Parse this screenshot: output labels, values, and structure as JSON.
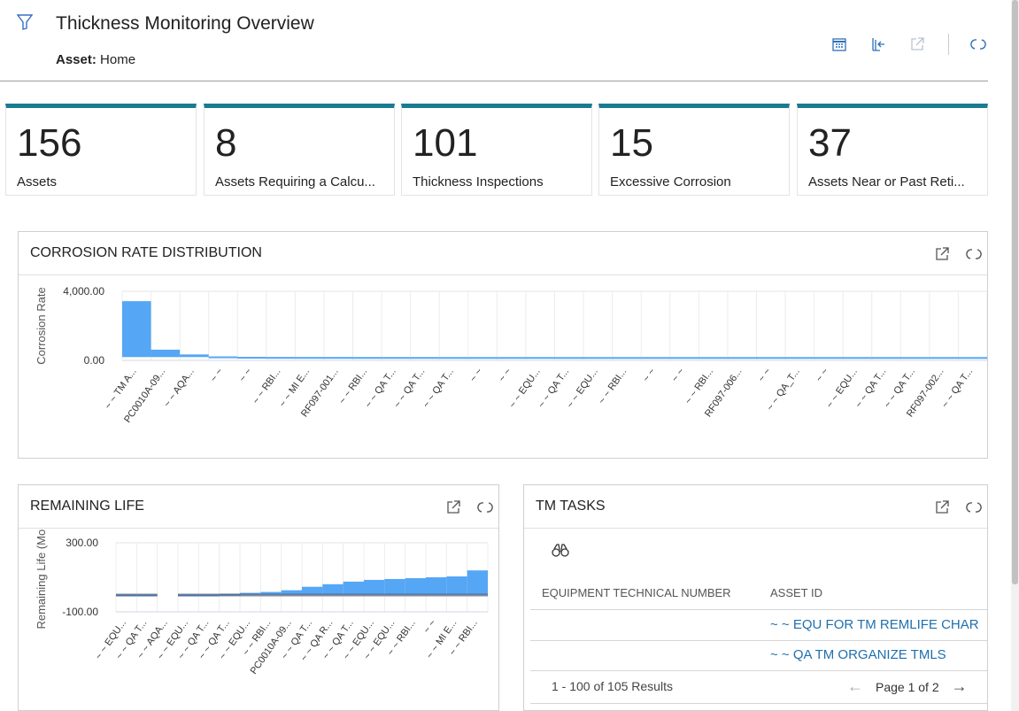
{
  "header": {
    "title": "Thickness Monitoring Overview",
    "asset_label": "Asset:",
    "asset_value": "Home",
    "tools": [
      "calendar-icon",
      "import-icon",
      "open-external-icon",
      "refresh-icon"
    ]
  },
  "kpis": [
    {
      "value": "156",
      "label": "Assets"
    },
    {
      "value": "8",
      "label": "Assets Requiring a Calcu..."
    },
    {
      "value": "101",
      "label": "Thickness Inspections"
    },
    {
      "value": "15",
      "label": "Excessive Corrosion"
    },
    {
      "value": "37",
      "label": "Assets Near or Past Reti..."
    }
  ],
  "colors": {
    "accent": "#1a7b91",
    "bar": "#55a6f5",
    "link": "#1f6fad"
  },
  "corrosion_panel": {
    "title": "CORROSION RATE DISTRIBUTION"
  },
  "remaining_panel": {
    "title": "REMAINING LIFE"
  },
  "tm_tasks": {
    "title": "TM TASKS",
    "columns": [
      "EQUIPMENT TECHNICAL NUMBER",
      "ASSET ID"
    ],
    "rows": [
      {
        "equipment": "",
        "asset_id": "~ ~ EQU FOR TM REMLIFE CHAR"
      },
      {
        "equipment": "",
        "asset_id": "~ ~ QA TM ORGANIZE TMLS"
      }
    ],
    "results": "1 - 100 of 105 Results",
    "page": "Page 1 of 2"
  },
  "chart_data": [
    {
      "type": "bar",
      "title": "CORROSION RATE DISTRIBUTION",
      "ylabel": "Corrosion Rate",
      "ytick_labels": [
        "4,000.00",
        "0.00"
      ],
      "ylim": [
        -200,
        4000
      ],
      "categories": [
        "~ ~ TM A...",
        "PC0010A-09...",
        "~ ~ AQA...",
        "~ ~",
        "~ ~",
        "~ ~ RBI...",
        "~ ~ MI E...",
        "RF097-001...",
        "~ ~ RBI...",
        "~ ~ QA T...",
        "~ ~ QA T...",
        "~ ~ QA T...",
        "~ ~",
        "~ ~",
        "~ ~ EQU...",
        "~ ~ QA T...",
        "~ ~ EQU...",
        "~ ~ RBI...",
        "~ ~",
        "~ ~",
        "~ ~ RBI...",
        "RF097-006...",
        "~ ~",
        "~ ~ QA_T...",
        "~ ~",
        "~ ~ EQU...",
        "~ ~ QA T...",
        "~ ~ QA T...",
        "RF097-002...",
        "~ ~ QA T..."
      ],
      "values": [
        3400,
        450,
        160,
        40,
        15,
        8,
        6,
        5,
        4,
        3,
        3,
        2,
        2,
        2,
        2,
        1,
        1,
        1,
        1,
        1,
        1,
        1,
        1,
        1,
        1,
        1,
        1,
        1,
        1,
        1
      ]
    },
    {
      "type": "area",
      "title": "REMAINING LIFE",
      "ylabel": "Remaining Life (Mor",
      "ytick_labels": [
        "300.00",
        "-100.00"
      ],
      "ylim": [
        -100,
        300
      ],
      "categories": [
        "~ ~ EQU...",
        "~ ~ QA T...",
        "~ ~ AQA...",
        "~ ~ EQU...",
        "~ ~ QA T...",
        "~ ~ QA T...",
        "~ ~ EQU...",
        "~ ~ RBI...",
        "PC0010A-09...",
        "~ ~ QA T...",
        "~ ~ QA R...",
        "~ ~ QA T...",
        "~ ~ EQU...",
        "~ ~ EQU...",
        "~ ~ RBI...",
        "~ ~",
        "~ ~ MI E...",
        "~ ~ RBI..."
      ],
      "values": [
        -10,
        -10,
        null,
        0,
        0,
        5,
        10,
        15,
        25,
        45,
        60,
        75,
        85,
        90,
        95,
        100,
        105,
        140
      ]
    }
  ]
}
